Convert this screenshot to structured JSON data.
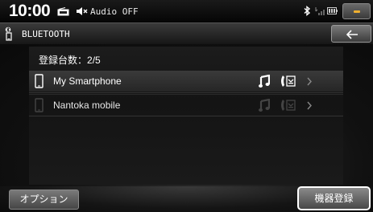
{
  "status_bar": {
    "clock": "10:00",
    "audio_status": "Audio OFF",
    "icons": [
      "source-icon",
      "mute-icon",
      "bluetooth-icon",
      "signal-icon",
      "battery-icon"
    ]
  },
  "header": {
    "title": "BLUETOOTH",
    "back_icon": "back-arrow-icon"
  },
  "main": {
    "count_label": "登録台数：",
    "count_value": "2/5",
    "devices": [
      {
        "name": "My Smartphone",
        "selected": true,
        "icons": [
          "phone-icon",
          "music-icon",
          "handsfree-phone-icon",
          "chevron-right-icon"
        ]
      },
      {
        "name": "Nantoka mobile",
        "selected": false,
        "icons": [
          "phone-icon",
          "music-icon",
          "handsfree-phone-icon",
          "chevron-right-icon"
        ]
      }
    ]
  },
  "footer": {
    "options_label": "オプション",
    "register_label": "機器登録"
  },
  "colors": {
    "accent": "#f0b030",
    "active_icon": "#ffffff",
    "inactive_icon": "#444444"
  }
}
